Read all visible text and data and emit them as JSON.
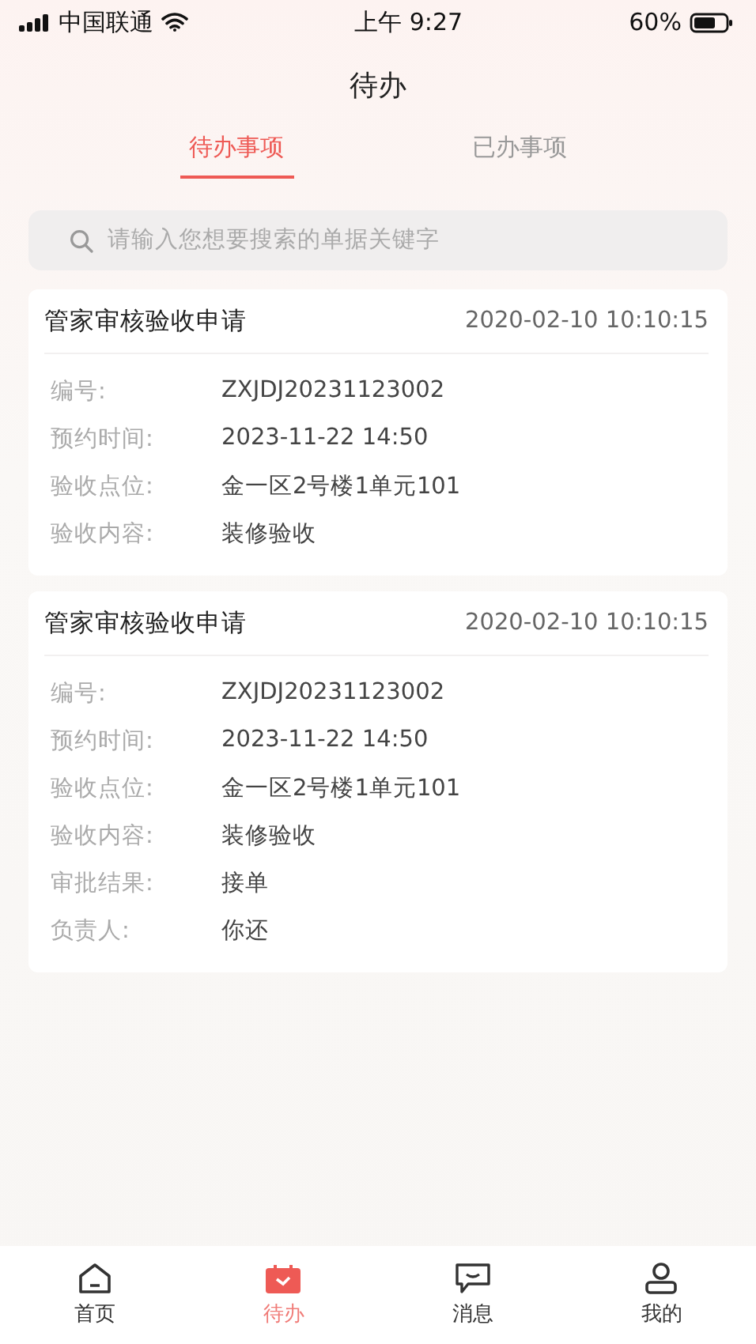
{
  "status_bar": {
    "carrier": "中国联通",
    "time": "上午 9:27",
    "battery": "60%"
  },
  "title": "待办",
  "tabs": [
    {
      "label": "待办事项",
      "selected": true
    },
    {
      "label": "已办事项",
      "selected": false
    }
  ],
  "search": {
    "placeholder": "请输入您想要搜索的单据关键字"
  },
  "cards": [
    {
      "title": "管家审核验收申请",
      "time": "2020-02-10 10:10:15",
      "fields": [
        {
          "label": "编号:",
          "value": "ZXJDJ20231123002"
        },
        {
          "label": "预约时间:",
          "value": "2023-11-22 14:50"
        },
        {
          "label": "验收点位:",
          "value": "金一区2号楼1单元101"
        },
        {
          "label": "验收内容:",
          "value": "装修验收"
        }
      ]
    },
    {
      "title": "管家审核验收申请",
      "time": "2020-02-10 10:10:15",
      "fields": [
        {
          "label": "编号:",
          "value": "ZXJDJ20231123002"
        },
        {
          "label": "预约时间:",
          "value": "2023-11-22 14:50"
        },
        {
          "label": "验收点位:",
          "value": "金一区2号楼1单元101"
        },
        {
          "label": "验收内容:",
          "value": "装修验收"
        },
        {
          "label": "审批结果:",
          "value": "接单"
        },
        {
          "label": "负责人:",
          "value": "你还"
        }
      ]
    }
  ],
  "nav": [
    {
      "label": "首页",
      "selected": false
    },
    {
      "label": "待办",
      "selected": true
    },
    {
      "label": "消息",
      "selected": false
    },
    {
      "label": "我的",
      "selected": false
    }
  ]
}
